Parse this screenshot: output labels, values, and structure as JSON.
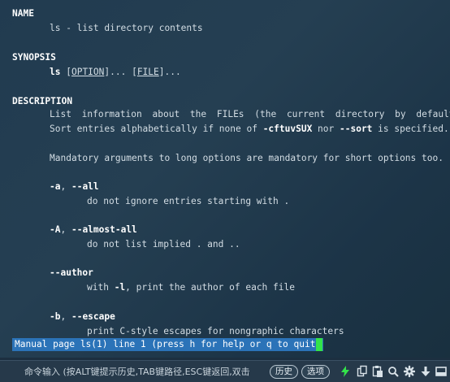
{
  "manpage": {
    "name_heading": "NAME",
    "name_line": "ls - list directory contents",
    "synopsis_heading": "SYNOPSIS",
    "synopsis": {
      "cmd": "ls",
      "sep1": " [",
      "option": "OPTION",
      "sep2": "]... [",
      "file": "FILE",
      "sep3": "]..."
    },
    "description_heading": "DESCRIPTION",
    "desc_line1": "List information about the FILEs (the current directory by default).",
    "desc_line2": {
      "a": "Sort entries alphabetically if none of ",
      "flags": "-cftuvSUX",
      "b": " nor ",
      "sort": "--sort",
      "c": " is specified."
    },
    "desc_line3": "Mandatory arguments to long options are mandatory for short options too.",
    "options": [
      {
        "flag_short": "-a",
        "sep": ", ",
        "flag_long": "--all",
        "desc": "do not ignore entries starting with ."
      },
      {
        "flag_short": "-A",
        "sep": ", ",
        "flag_long": "--almost-all",
        "desc": "do not list implied . and .."
      },
      {
        "flag_short": "",
        "sep": "",
        "flag_long": "--author",
        "desc_pre": "with ",
        "desc_flag": "-l",
        "desc_post": ", print the author of each file"
      },
      {
        "flag_short": "-b",
        "sep": ", ",
        "flag_long": "--escape",
        "desc": "print C-style escapes for nongraphic characters"
      }
    ]
  },
  "status_line": "Manual page ls(1) line 1 (press h for help or q to quit)",
  "command_bar": {
    "placeholder": "命令输入 (按ALT键提示历史,TAB键路径,ESC键返回,双击",
    "history_label": "历史",
    "options_label": "选项",
    "icons": [
      "lightning-icon",
      "copy-icon",
      "paste-icon",
      "search-icon",
      "gear-icon",
      "download-arrow-icon",
      "panel-icon"
    ],
    "accent_color": "#33e34a"
  },
  "colors": {
    "status_bg": "#2b73b8",
    "cursor": "#33e34a",
    "text": "#d3dde4"
  }
}
